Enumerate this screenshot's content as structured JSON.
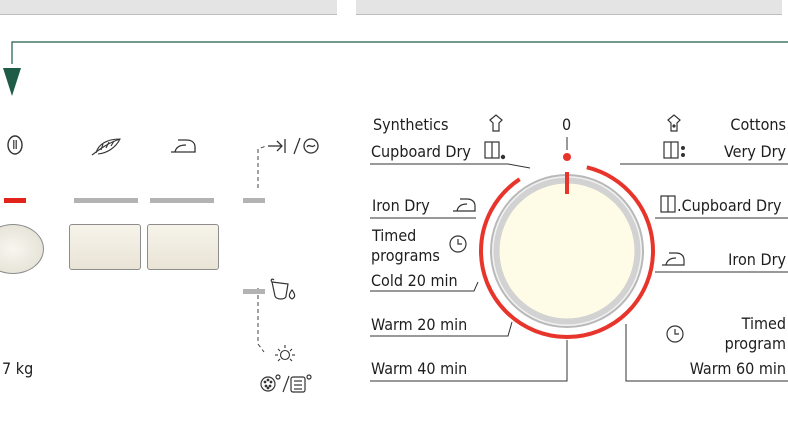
{
  "colors": {
    "arrow": "#1f5c48",
    "indicator_active": "#e2231a",
    "indicator_inactive": "#b3b3b3",
    "dial_ring": "#e8352b",
    "dial_face": "#fefbe6"
  },
  "panel": {
    "capacity": "7 kg",
    "power_icon": "power-icon",
    "delicate_icon": "feather-icon",
    "iron_icon": "iron-icon",
    "end_icons": "→|/⟳",
    "water_icon": "water-container-icon",
    "filter_icons": "filter-clean-icons"
  },
  "dial": {
    "zero": "0",
    "left": {
      "synthetics": "Synthetics",
      "cupboard_dry": "Cupboard Dry",
      "iron_dry": "Iron Dry",
      "timed": "Timed",
      "programs": "programs",
      "cold_20": "Cold 20 min",
      "warm_20": "Warm 20 min",
      "warm_40": "Warm 40 min"
    },
    "right": {
      "cottons": "Cottons",
      "very_dry": "Very Dry",
      "cupboard_dry": ".Cupboard Dry",
      "iron_dry": "Iron Dry",
      "timed": "Timed",
      "program": "program",
      "warm_60": "Warm  60 min"
    }
  }
}
